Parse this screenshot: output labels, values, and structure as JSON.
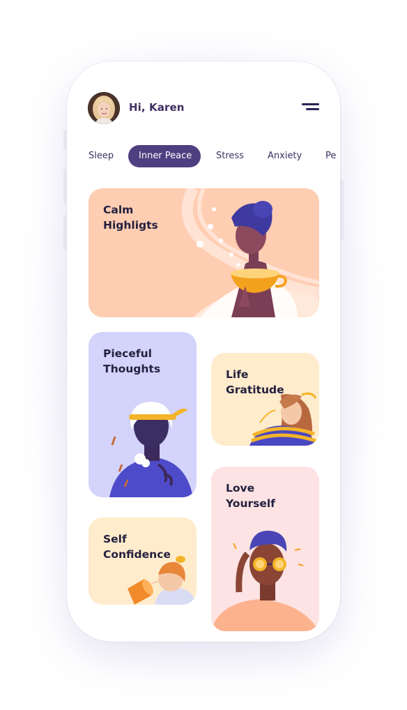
{
  "user": {
    "greeting": "Hi, Karen"
  },
  "icons": {
    "avatar": "avatar-photo",
    "menu": "hamburger-menu-icon"
  },
  "tabs": [
    {
      "label": "Sleep",
      "active": false
    },
    {
      "label": "Inner Peace",
      "active": true
    },
    {
      "label": "Stress",
      "active": false
    },
    {
      "label": "Anxiety",
      "active": false
    },
    {
      "label": "Pe",
      "active": false
    }
  ],
  "cards": {
    "calm": {
      "title": "Calm\nHighligts",
      "color": "#ffcdb2"
    },
    "pieceful": {
      "title": "Pieceful\nThoughts",
      "color": "#d4d3fb"
    },
    "gratitude": {
      "title": "Life\nGratitude",
      "color": "#ffeccc"
    },
    "confidence": {
      "title": "Self\nConfidence",
      "color": "#ffeccc"
    },
    "love": {
      "title": "Love\nYourself",
      "color": "#fde3e3"
    }
  },
  "colors": {
    "accent": "#4e3f80",
    "text": "#24203f"
  }
}
